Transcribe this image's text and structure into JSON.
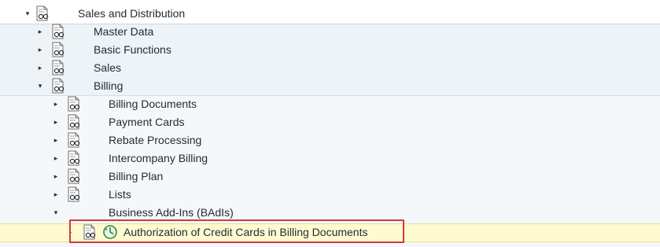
{
  "tree": {
    "root": {
      "label": "Sales and Distribution",
      "expander": "▾"
    },
    "level1": [
      {
        "label": "Master Data",
        "expander": "▸"
      },
      {
        "label": "Basic Functions",
        "expander": "▸"
      },
      {
        "label": "Sales",
        "expander": "▸"
      },
      {
        "label": "Billing",
        "expander": "▾"
      }
    ],
    "level2": [
      {
        "label": "Billing Documents",
        "expander": "▸"
      },
      {
        "label": "Payment Cards",
        "expander": "▸"
      },
      {
        "label": "Rebate Processing",
        "expander": "▸"
      },
      {
        "label": "Intercompany Billing",
        "expander": "▸"
      },
      {
        "label": "Billing Plan",
        "expander": "▸"
      },
      {
        "label": "Lists",
        "expander": "▸"
      },
      {
        "label": "Business Add-Ins (BAdIs)",
        "expander": "▾"
      }
    ],
    "level3": [
      {
        "label": "Authorization of Credit Cards in Billing Documents",
        "expander": "·"
      }
    ]
  },
  "colors": {
    "selection_fill": "#fffbd1",
    "highlight_border": "#d23a3a",
    "execute_icon": "#2e8b3a"
  },
  "icons": {
    "node": "img-glasses-doc-icon",
    "activity": "execute-clock-icon"
  }
}
